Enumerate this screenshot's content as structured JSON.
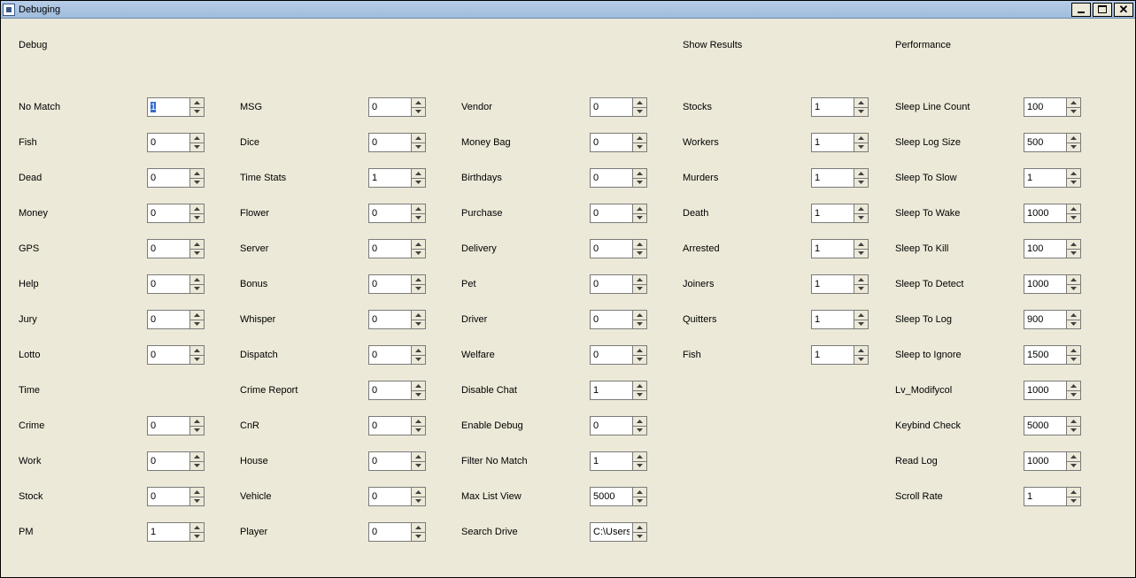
{
  "window": {
    "title": "Debuging"
  },
  "sections": {
    "debug": "Debug",
    "show_results": "Show Results",
    "performance": "Performance"
  },
  "col1": [
    {
      "label": "No Match",
      "value": "1",
      "selected": true
    },
    {
      "label": "Fish",
      "value": "0"
    },
    {
      "label": "Dead",
      "value": "0"
    },
    {
      "label": "Money",
      "value": "0"
    },
    {
      "label": "GPS",
      "value": "0"
    },
    {
      "label": "Help",
      "value": "0"
    },
    {
      "label": "Jury",
      "value": "0"
    },
    {
      "label": "Lotto",
      "value": "0"
    },
    {
      "label": "Time",
      "value": null
    },
    {
      "label": "Crime",
      "value": "0"
    },
    {
      "label": "Work",
      "value": "0"
    },
    {
      "label": "Stock",
      "value": "0"
    },
    {
      "label": "PM",
      "value": "1"
    }
  ],
  "col2": [
    {
      "label": "MSG",
      "value": "0"
    },
    {
      "label": "Dice",
      "value": "0"
    },
    {
      "label": "Time Stats",
      "value": "1"
    },
    {
      "label": "Flower",
      "value": "0"
    },
    {
      "label": "Server",
      "value": "0"
    },
    {
      "label": "Bonus",
      "value": "0"
    },
    {
      "label": "Whisper",
      "value": "0"
    },
    {
      "label": "Dispatch",
      "value": "0"
    },
    {
      "label": "Crime Report",
      "value": "0"
    },
    {
      "label": "CnR",
      "value": "0"
    },
    {
      "label": "House",
      "value": "0"
    },
    {
      "label": "Vehicle",
      "value": "0"
    },
    {
      "label": "Player",
      "value": "0"
    }
  ],
  "col3": [
    {
      "label": "Vendor",
      "value": "0"
    },
    {
      "label": "Money Bag",
      "value": "0"
    },
    {
      "label": "Birthdays",
      "value": "0"
    },
    {
      "label": "Purchase",
      "value": "0"
    },
    {
      "label": "Delivery",
      "value": "0"
    },
    {
      "label": "Pet",
      "value": "0"
    },
    {
      "label": "Driver",
      "value": "0"
    },
    {
      "label": "Welfare",
      "value": "0"
    },
    {
      "label": "Disable Chat",
      "value": "1"
    },
    {
      "label": "Enable Debug",
      "value": "0"
    },
    {
      "label": "Filter No Match",
      "value": "1"
    },
    {
      "label": "Max List View",
      "value": "5000"
    },
    {
      "label": "Search Drive",
      "value": "C:\\Users"
    }
  ],
  "col4": [
    {
      "label": "Stocks",
      "value": "1"
    },
    {
      "label": "Workers",
      "value": "1"
    },
    {
      "label": "Murders",
      "value": "1"
    },
    {
      "label": "Death",
      "value": "1"
    },
    {
      "label": "Arrested",
      "value": "1"
    },
    {
      "label": "Joiners",
      "value": "1"
    },
    {
      "label": "Quitters",
      "value": "1"
    },
    {
      "label": "Fish",
      "value": "1"
    }
  ],
  "col5": [
    {
      "label": "Sleep Line Count",
      "value": "100"
    },
    {
      "label": "Sleep Log Size",
      "value": "500"
    },
    {
      "label": "Sleep To Slow",
      "value": "1"
    },
    {
      "label": "Sleep To Wake",
      "value": "1000"
    },
    {
      "label": "Sleep To Kill",
      "value": "100"
    },
    {
      "label": "Sleep To Detect",
      "value": "1000"
    },
    {
      "label": "Sleep To Log",
      "value": "900"
    },
    {
      "label": "Sleep to Ignore",
      "value": "1500"
    },
    {
      "label": "Lv_Modifycol",
      "value": "1000"
    },
    {
      "label": "Keybind Check",
      "value": "5000"
    },
    {
      "label": "Read Log",
      "value": "1000"
    },
    {
      "label": "Scroll Rate",
      "value": "1"
    }
  ]
}
